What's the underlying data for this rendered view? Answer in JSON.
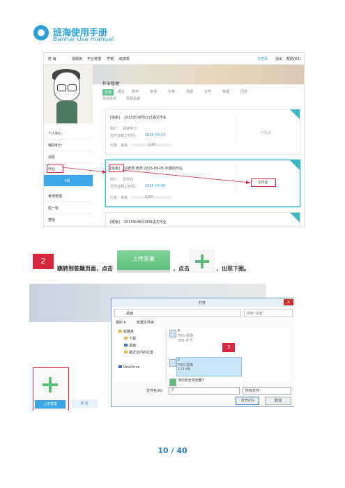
{
  "header": {
    "title_cn": "班海使用手册",
    "title_en": "Banhai Use manual"
  },
  "shot1": {
    "topbar": {
      "logo": "班 海",
      "nav": [
        "视频库",
        "平台管理",
        "学校",
        "班级帮"
      ],
      "user": "王老师",
      "logout": "退出",
      "help": "帮助(63)"
    },
    "sidemenu": {
      "items": [
        "个人中心",
        "我的积分",
        "消息",
        "作业",
        "Ⅱ班",
        "考场管理",
        "班一班",
        "答疑"
      ]
    },
    "panel_title": "作业管理",
    "tabs": [
      "全部",
      "语文",
      "数学",
      "英语",
      "生物",
      "地理",
      "化学",
      "物理",
      "历史",
      "信息技术",
      "思想品德"
    ],
    "cards": [
      {
        "tag": "[班级]",
        "title": "2015年09月01日语文作业",
        "l1_label": "简介：",
        "l1_value": "阅读学习",
        "l2_label": "交作业截止时间：",
        "l2_value": "2015-09-23",
        "progress": "已批：未批",
        "count": "1/49",
        "status": "已完成"
      },
      {
        "tag": "[班级]",
        "title": "刘老师 老师 2015-09-05 布置的作业",
        "l1_label": "简介：",
        "l1_value": "写作业",
        "l2_label": "交作业截止时间：",
        "l2_value": "2015-09-06",
        "progress": "已批：未批",
        "count": "0/50",
        "status": "写作业"
      },
      {
        "tag": "[班级]",
        "title": "2015年08月28日语文作业"
      }
    ]
  },
  "step2": {
    "number": "2",
    "text_a": "跳转到答题页面，点击",
    "upload_label": "上传答案",
    "text_b": "，点击",
    "text_c": "，出现下图。"
  },
  "shot2": {
    "upload_tile": "上传答案",
    "browse_tab": "浏 览",
    "dialog": {
      "title": "打开",
      "close": "✕",
      "address": "桌面",
      "search": "搜索“桌面”",
      "organize": "组织 ▾",
      "new_folder": "新建文件夹",
      "nav": [
        "收藏夹",
        "下载",
        "桌面",
        "最近访问的位置",
        "OneDrive"
      ],
      "files": [
        {
          "name": "6",
          "type": "PNG 图像",
          "size": "308 字节"
        },
        {
          "name": "7",
          "type": "PNG 图像",
          "size": "123 KB"
        },
        {
          "name": "360安全浏览器7"
        }
      ],
      "step": "3",
      "filename_label": "文件名(N):",
      "filename_value": "7",
      "filetype": "所有文件",
      "open": "打开(O)",
      "cancel": "取消"
    }
  },
  "page_number": "10 / 40"
}
